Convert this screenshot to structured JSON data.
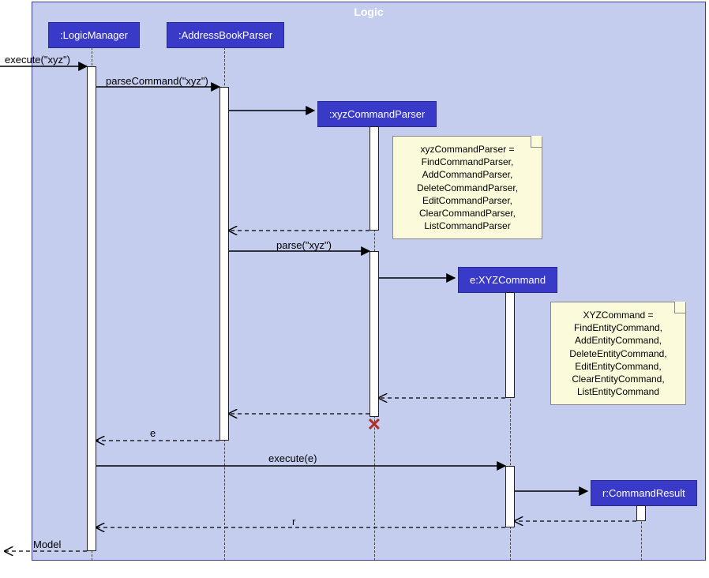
{
  "frame": {
    "title": "Logic"
  },
  "participants": {
    "logicManager": ":LogicManager",
    "addressBookParser": ":AddressBookParser",
    "xyzCommandParser": ":xyzCommandParser",
    "xyzCommand": "e:XYZCommand",
    "commandResult": "r:CommandResult"
  },
  "messages": {
    "execute_xyz": "execute(\"xyz\")",
    "parseCommand": "parseCommand(\"xyz\")",
    "parse": "parse(\"xyz\")",
    "return_e": "e",
    "execute_e": "execute(e)",
    "return_r": "r",
    "model": "Model"
  },
  "notes": {
    "parser_note": "xyzCommandParser =\nFindCommandParser,\nAddCommandParser,\nDeleteCommandParser,\nEditCommandParser,\nClearCommandParser,\nListCommandParser",
    "command_note": "XYZCommand =\nFindEntityCommand,\nAddEntityCommand,\nDeleteEntityCommand,\nEditEntityCommand,\nClearEntityCommand,\nListEntityCommand"
  }
}
